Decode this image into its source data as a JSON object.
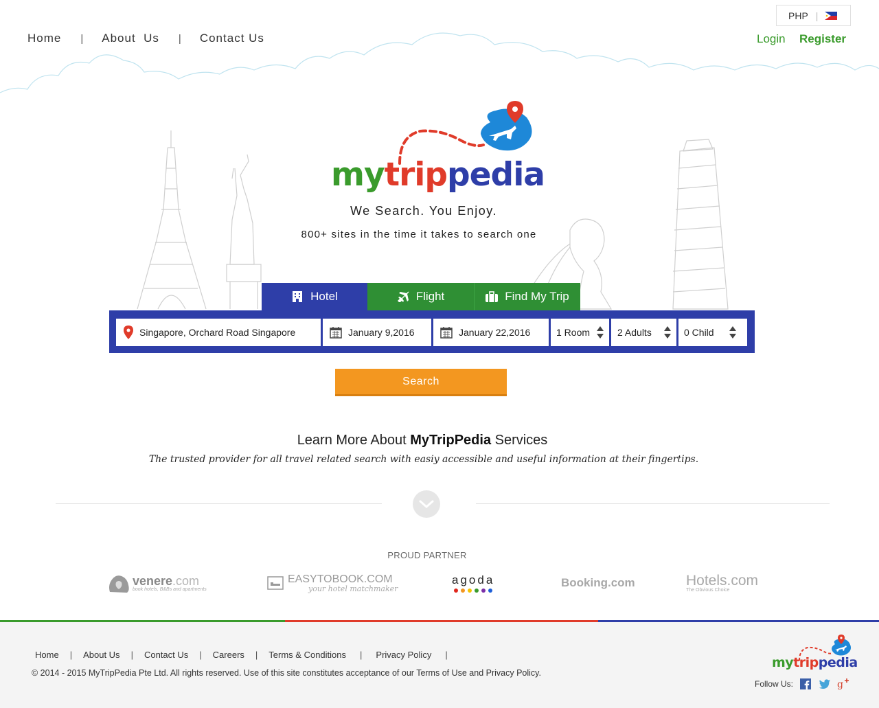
{
  "header": {
    "nav": [
      {
        "label": "Home"
      },
      {
        "label": "About  Us"
      },
      {
        "label": "Contact Us"
      }
    ],
    "nav_separator": "|",
    "currency": "PHP",
    "currency_separator": "|",
    "login_label": "Login",
    "register_label": "Register"
  },
  "hero": {
    "logo": {
      "my": "my",
      "trip": "trip",
      "pedia": "pedia"
    },
    "tagline": "We Search. You Enjoy.",
    "subtagline": "800+ sites in the time it takes to search one"
  },
  "tabs": [
    {
      "label": "Hotel",
      "icon": "building-icon",
      "active": true
    },
    {
      "label": "Flight",
      "icon": "airplane-icon",
      "active": false
    },
    {
      "label": "Find My Trip",
      "icon": "suitcase-icon",
      "active": false
    }
  ],
  "search": {
    "destination": "Singapore, Orchard Road Singapore",
    "check_in": "January 9,2016",
    "check_out": "January 22,2016",
    "rooms": "1 Room",
    "adults": "2 Adults",
    "children": "0 Child",
    "button_label": "Search"
  },
  "learn": {
    "prefix": "Learn More About ",
    "brand": "MyTripPedia",
    "suffix": " Services",
    "subtitle": "The trusted provider for all travel related search with easiy accessible and useful information at their fingertips."
  },
  "partners": {
    "label": "PROUD PARTNER",
    "items": [
      {
        "name": "venere",
        "suffix": ".com",
        "tagline": "book hotels, B&Bs and apartments"
      },
      {
        "name": "EASYTOBOOK.COM",
        "tagline": "your hotel matchmaker"
      },
      {
        "name": "agoda"
      },
      {
        "name": "Booking.com"
      },
      {
        "name": "Hotels.com",
        "tagline": "The Obvious Choice"
      }
    ]
  },
  "footer": {
    "nav": [
      {
        "label": "Home"
      },
      {
        "label": "About Us"
      },
      {
        "label": "Contact Us"
      },
      {
        "label": "Careers"
      },
      {
        "label": "Terms & Conditions"
      },
      {
        "label": "Privacy Policy"
      }
    ],
    "separator": "|",
    "copyright": "© 2014 - 2015 MyTripPedia Pte Ltd. All rights reserved. Use of this site constitutes acceptance of our Terms of Use and Privacy Policy.",
    "follow_label": "Follow Us:",
    "social": [
      "facebook-icon",
      "twitter-icon",
      "google-plus-icon"
    ]
  },
  "colors": {
    "brand_green": "#3a9b2c",
    "brand_red": "#e03b2a",
    "brand_blue": "#2e3ea8",
    "tab_green": "#2f8f34",
    "search_orange": "#f39720"
  }
}
